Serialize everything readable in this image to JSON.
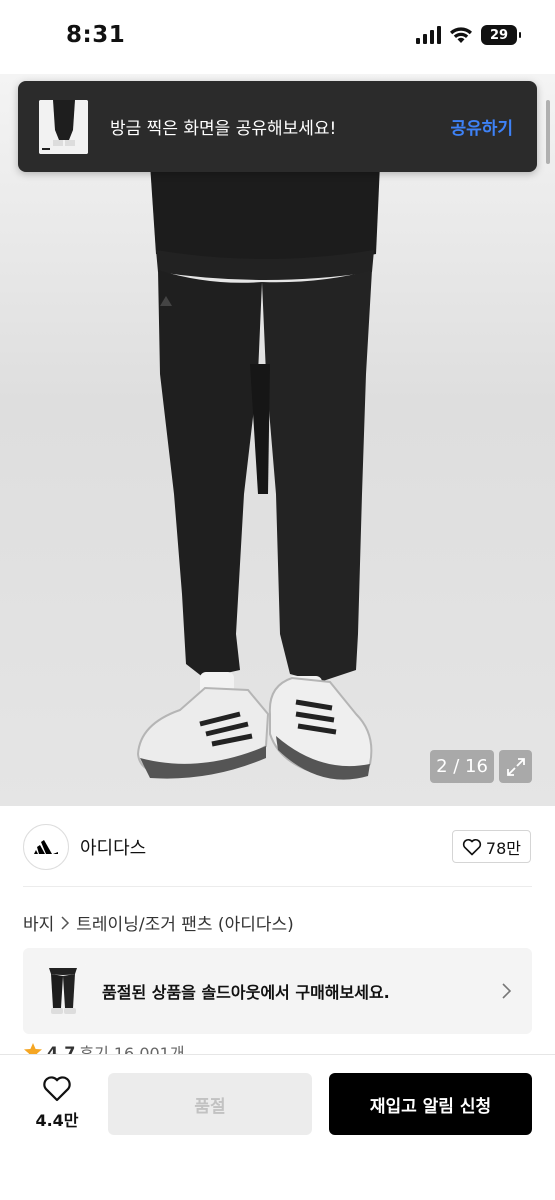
{
  "status_bar": {
    "time": "8:31",
    "battery": "29"
  },
  "toast": {
    "message": "방금 찍은 화면을 공유해보세요!",
    "action": "공유하기"
  },
  "gallery": {
    "counter": "2 / 16"
  },
  "brand": {
    "name": "아디다스",
    "likes": "78만"
  },
  "breadcrumb": {
    "category": "바지",
    "subcategory": "트레이닝/조거 팬츠 (아디다스)"
  },
  "soldout_banner": {
    "text": "품절된 상품을 솔드아웃에서 구매해보세요."
  },
  "rating": {
    "score": "4.7",
    "reviews": "후기 16,001개"
  },
  "bottom_bar": {
    "wish_count": "4.4만",
    "soldout_label": "품절",
    "restock_label": "재입고 알림 신청"
  },
  "colors": {
    "accent_blue": "#3e82f7",
    "toast_bg": "#2b2b2b",
    "cta_bg": "#000000",
    "disabled_bg": "#ececec"
  }
}
